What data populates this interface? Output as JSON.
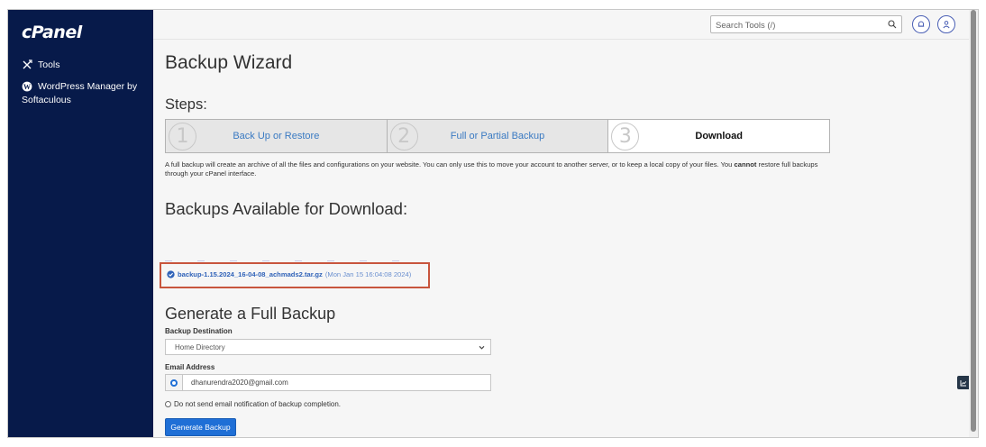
{
  "sidebar": {
    "logo": "cPanel",
    "items": [
      {
        "label": "Tools",
        "icon": "tools-icon"
      },
      {
        "label_line1": "WordPress Manager by",
        "label_line2": "Softaculous",
        "icon": "wordpress-icon"
      }
    ]
  },
  "header": {
    "search_placeholder": "Search Tools (/)"
  },
  "main": {
    "title": "Backup Wizard",
    "steps_title": "Steps:",
    "steps": [
      {
        "number": "1",
        "label": "Back Up or Restore"
      },
      {
        "number": "2",
        "label": "Full or Partial Backup"
      },
      {
        "number": "3",
        "label": "Download",
        "active": true
      }
    ],
    "description_pre": "A full backup will create an archive of all the files and configurations on your website. You can only use this to move your account to another server, or to keep a local copy of your files. You",
    "description_bold": "cannot",
    "description_post": "restore full backups through your cPanel interface.",
    "available_title": "Backups Available for Download:",
    "backup_file": "backup-1.15.2024_16-04-08_achmads2.tar.gz",
    "backup_date": "(Mon Jan 15 16:04:08 2024)",
    "generate_title": "Generate a Full Backup",
    "destination_label": "Backup Destination",
    "destination_value": "Home Directory",
    "email_label": "Email Address",
    "email_value": "dhanurendra2020@gmail.com",
    "no_email_label": "Do not send email notification of backup completion.",
    "generate_button": "Generate Backup"
  },
  "colors": {
    "sidebar_bg": "#071a4a",
    "link": "#3a7ac2",
    "primary_button": "#1f6fd6",
    "highlight_box": "#c8553d"
  }
}
